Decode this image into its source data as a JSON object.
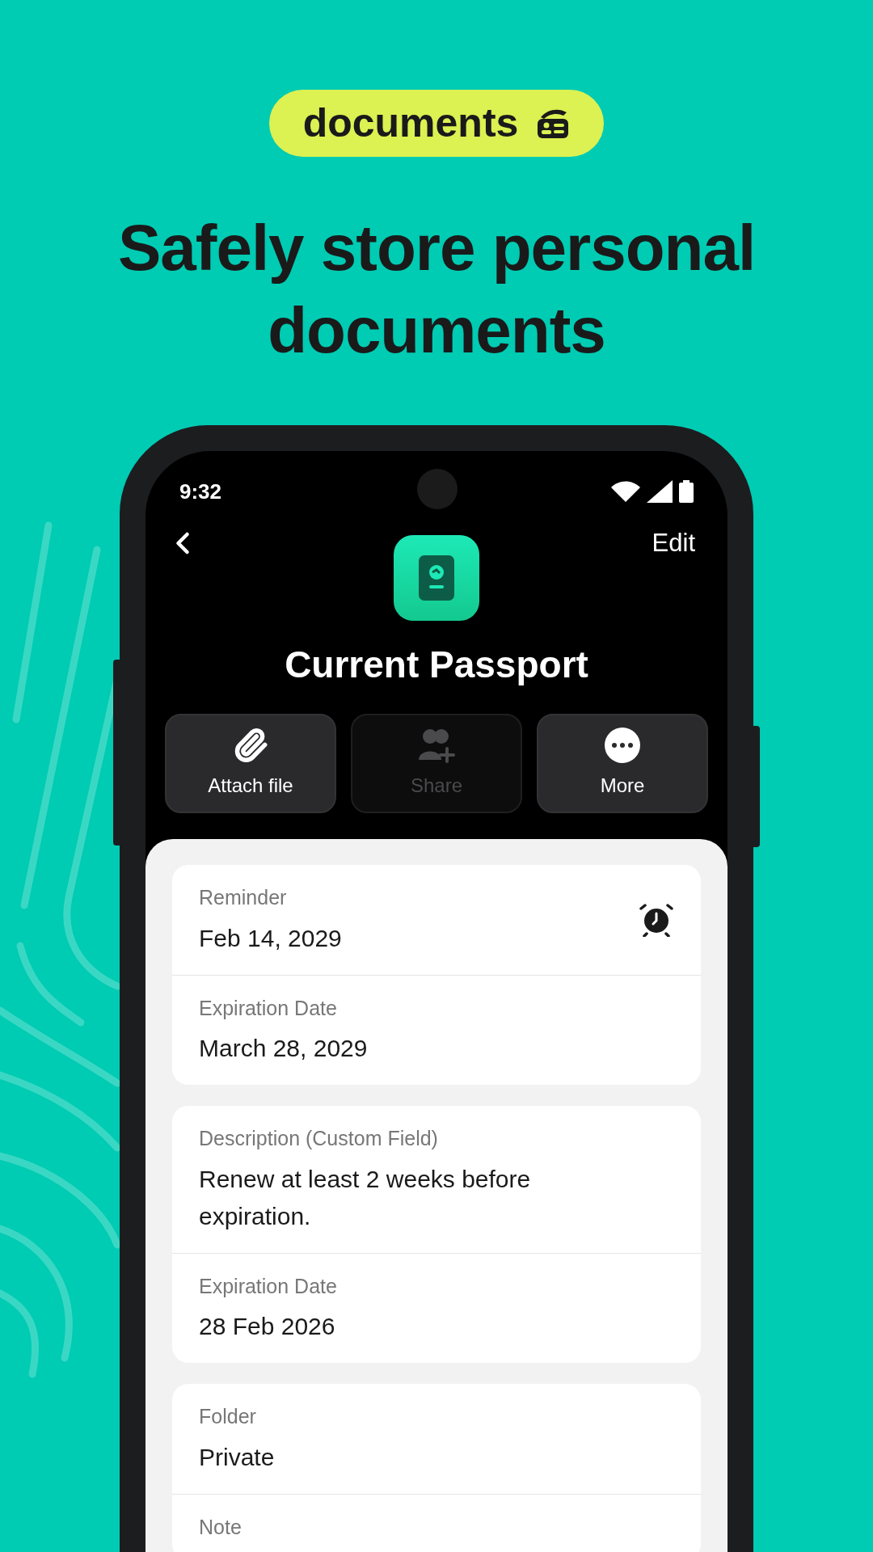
{
  "badge": {
    "label": "documents"
  },
  "headline": "Safely store personal documents",
  "phone": {
    "status_bar": {
      "time": "9:32"
    },
    "nav": {
      "edit": "Edit"
    },
    "title": "Current Passport",
    "actions": [
      {
        "kind": "attach",
        "label": "Attach file",
        "disabled": false
      },
      {
        "kind": "share",
        "label": "Share",
        "disabled": true
      },
      {
        "kind": "more",
        "label": "More",
        "disabled": false
      }
    ],
    "sections": [
      {
        "fields": [
          {
            "kind": "reminder",
            "label": "Reminder",
            "value": "Feb 14, 2029"
          },
          {
            "kind": "plain",
            "label": "Expiration Date",
            "value": "March 28, 2029"
          }
        ]
      },
      {
        "fields": [
          {
            "kind": "plain",
            "label": "Description (Custom Field)",
            "value": "Renew at least 2 weeks before expiration."
          },
          {
            "kind": "plain",
            "label": "Expiration Date",
            "value": "28 Feb 2026"
          }
        ]
      },
      {
        "fields": [
          {
            "kind": "plain",
            "label": "Folder",
            "value": "Private"
          },
          {
            "kind": "plain",
            "label": "Note"
          }
        ]
      }
    ]
  }
}
